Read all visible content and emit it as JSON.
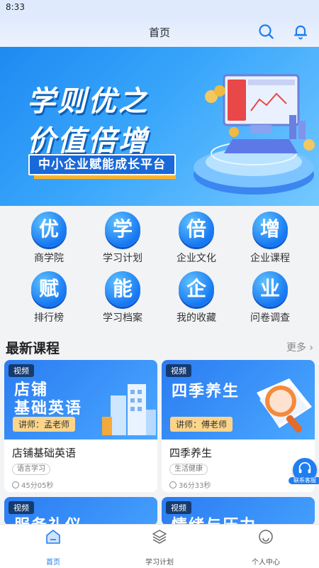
{
  "status_bar": {
    "time": "8:33"
  },
  "header": {
    "title": "首页",
    "search_icon": "search-icon",
    "bell_icon": "bell-icon"
  },
  "banner": {
    "line1": "学则优之",
    "line2": "价值倍增",
    "tag": "中小企业赋能成长平台"
  },
  "grid": [
    {
      "char": "优",
      "label": "商学院"
    },
    {
      "char": "学",
      "label": "学习计划"
    },
    {
      "char": "倍",
      "label": "企业文化"
    },
    {
      "char": "增",
      "label": "企业课程"
    },
    {
      "char": "赋",
      "label": "排行榜"
    },
    {
      "char": "能",
      "label": "学习档案"
    },
    {
      "char": "企",
      "label": "我的收藏"
    },
    {
      "char": "业",
      "label": "问卷调查"
    }
  ],
  "section": {
    "title": "最新课程",
    "more": "更多 ›"
  },
  "courses": [
    {
      "tag": "视频",
      "thumb_line1": "店铺",
      "thumb_line2": "基础英语",
      "teacher": "讲师：孟老师",
      "name": "店铺基础英语",
      "category": "语言学习",
      "duration": "45分05秒"
    },
    {
      "tag": "视频",
      "thumb_line1": "四季养生",
      "thumb_line2": "",
      "teacher": "讲师：傅老师",
      "name": "四季养生",
      "category": "生活健康",
      "duration": "36分33秒"
    },
    {
      "tag": "视频",
      "thumb_line1": "服务礼仪",
      "thumb_line2": ""
    },
    {
      "tag": "视频",
      "thumb_line1": "情绪与压力",
      "thumb_line2": ""
    }
  ],
  "service": {
    "label": "联系客服",
    "icon": "headset-icon"
  },
  "tabs": [
    {
      "label": "首页",
      "icon": "home-icon",
      "active": true
    },
    {
      "label": "学习计划",
      "icon": "layers-icon",
      "active": false
    },
    {
      "label": "个人中心",
      "icon": "smile-icon",
      "active": false
    }
  ],
  "colors": {
    "primary": "#1f7ef0",
    "banner": "#2b90f5",
    "accent": "#ffb327"
  }
}
